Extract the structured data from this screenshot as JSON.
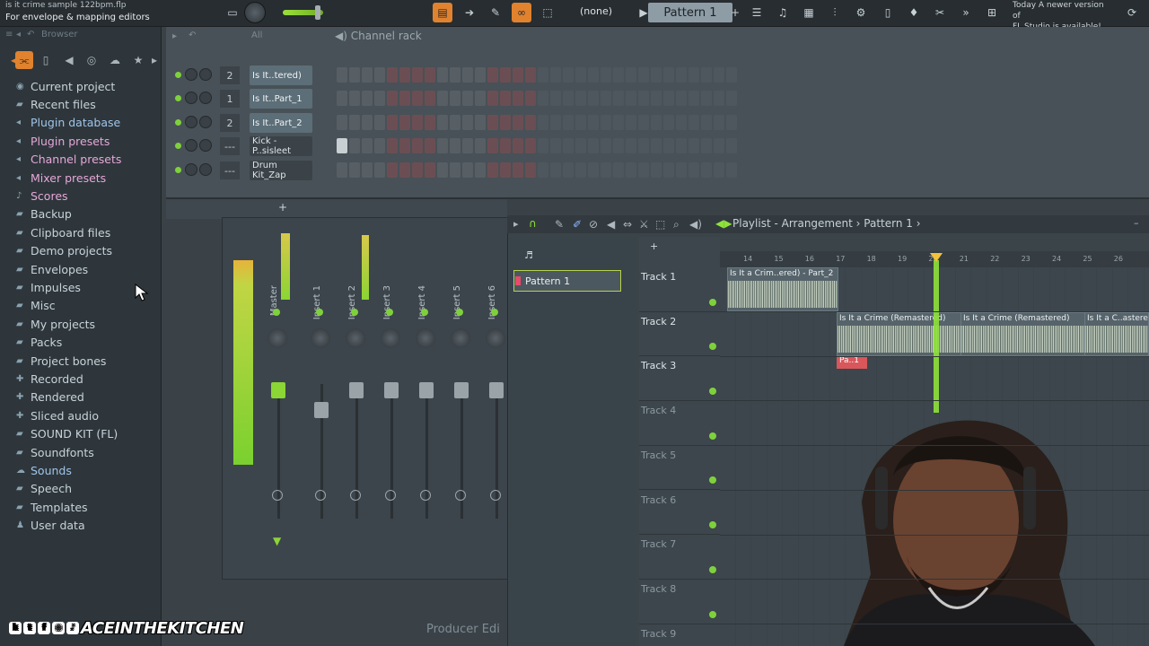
{
  "header": {
    "file_name": "is it crime sample 122bpm.flp",
    "hint": "For envelope & mapping editors",
    "selector_none": "(none)",
    "pattern_selector": "Pattern 1",
    "notice_line1": "Today  A newer version of",
    "notice_line2": "FL Studio is available!"
  },
  "browser": {
    "title": "Browser",
    "filter_all": "All",
    "items": [
      {
        "label": "Current project",
        "icon": "project-icon",
        "style": "normal"
      },
      {
        "label": "Recent files",
        "icon": "folder-icon",
        "style": "normal"
      },
      {
        "label": "Plugin database",
        "icon": "plugin-icon",
        "style": "blue"
      },
      {
        "label": "Plugin presets",
        "icon": "plugin-icon",
        "style": "pink"
      },
      {
        "label": "Channel presets",
        "icon": "plugin-icon",
        "style": "pink"
      },
      {
        "label": "Mixer presets",
        "icon": "plugin-icon",
        "style": "pink"
      },
      {
        "label": "Scores",
        "icon": "note-icon",
        "style": "pink"
      },
      {
        "label": "Backup",
        "icon": "folder-icon",
        "style": "normal"
      },
      {
        "label": "Clipboard files",
        "icon": "folder-icon",
        "style": "normal"
      },
      {
        "label": "Demo projects",
        "icon": "folder-icon",
        "style": "normal"
      },
      {
        "label": "Envelopes",
        "icon": "folder-icon",
        "style": "normal"
      },
      {
        "label": "Impulses",
        "icon": "folder-icon",
        "style": "normal"
      },
      {
        "label": "Misc",
        "icon": "folder-icon",
        "style": "normal"
      },
      {
        "label": "My projects",
        "icon": "folder-icon",
        "style": "normal"
      },
      {
        "label": "Packs",
        "icon": "folder-icon",
        "style": "normal"
      },
      {
        "label": "Project bones",
        "icon": "folder-icon",
        "style": "normal"
      },
      {
        "label": "Recorded",
        "icon": "plus-icon",
        "style": "normal"
      },
      {
        "label": "Rendered",
        "icon": "plus-icon",
        "style": "normal"
      },
      {
        "label": "Sliced audio",
        "icon": "plus-icon",
        "style": "normal"
      },
      {
        "label": "SOUND KIT (FL)",
        "icon": "folder-icon",
        "style": "normal"
      },
      {
        "label": "Soundfonts",
        "icon": "folder-icon",
        "style": "normal"
      },
      {
        "label": "Sounds",
        "icon": "cloud-icon",
        "style": "blue"
      },
      {
        "label": "Speech",
        "icon": "folder-icon",
        "style": "normal"
      },
      {
        "label": "Templates",
        "icon": "folder-icon",
        "style": "normal"
      },
      {
        "label": "User data",
        "icon": "user-icon",
        "style": "normal"
      }
    ]
  },
  "channel_rack": {
    "title": "Channel rack",
    "channels": [
      {
        "num": "2",
        "name": "Is It..tered)",
        "active": true
      },
      {
        "num": "1",
        "name": "Is It..Part_1",
        "active": true
      },
      {
        "num": "2",
        "name": "Is It..Part_2",
        "active": true
      },
      {
        "num": "---",
        "name": "Kick - P..sisleet",
        "active": false
      },
      {
        "num": "---",
        "name": "Drum Kit_Zap",
        "active": false
      }
    ]
  },
  "mixer": {
    "channels": [
      "Master",
      "Insert 1",
      "Insert 2",
      "Insert 3",
      "Insert 4",
      "Insert 5",
      "Insert 6"
    ]
  },
  "playlist": {
    "title": "Playlist - Arrangement",
    "pattern": "Pattern 1",
    "pattern_item": "Pattern 1",
    "bar_numbers": [
      "14",
      "15",
      "16",
      "17",
      "18",
      "19",
      "20",
      "21",
      "22",
      "23",
      "24",
      "25",
      "26"
    ],
    "tracks": [
      "Track 1",
      "Track 2",
      "Track 3",
      "Track 4",
      "Track 5",
      "Track 6",
      "Track 7",
      "Track 8",
      "Track 9"
    ],
    "clip_track1": "Is It a Crim..ered) - Part_2",
    "clip_track2a": "Is It a Crime (Remastered)",
    "clip_track2b": "Is It a Crime (Remastered)",
    "clip_track2c": "Is It a C..astere",
    "clip_track3": "Pa..1"
  },
  "overlay": {
    "watermark": "ACEINTHEKITCHEN",
    "producer_text": "Producer Edi"
  }
}
